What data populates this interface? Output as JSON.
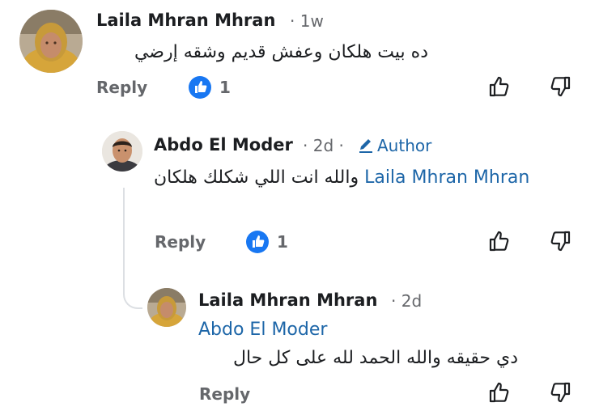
{
  "comments": [
    {
      "author": "Laila Mhran Mhran",
      "time": "· 1w",
      "text": "ده بيت هلكان وعفش قديم وشقه إرضي",
      "reply_label": "Reply",
      "like_count": "1"
    },
    {
      "author": "Abdo El Moder",
      "time": "· 2d ·",
      "badge": "Author",
      "mention": "Laila Mhran Mhran",
      "text": "والله انت اللي شكلك هلكان",
      "reply_label": "Reply",
      "like_count": "1"
    },
    {
      "author": "Laila Mhran Mhran",
      "time": "· 2d",
      "mention": "Abdo El Moder",
      "text": "دي حقيقه والله الحمد لله على كل حال",
      "reply_label": "Reply"
    }
  ],
  "colors": {
    "accent": "#1877f2",
    "link": "#1d66a8",
    "muted": "#65676b"
  },
  "icons": {
    "like": "thumbs-up-icon",
    "dislike": "thumbs-down-icon",
    "badge": "pen-icon"
  }
}
